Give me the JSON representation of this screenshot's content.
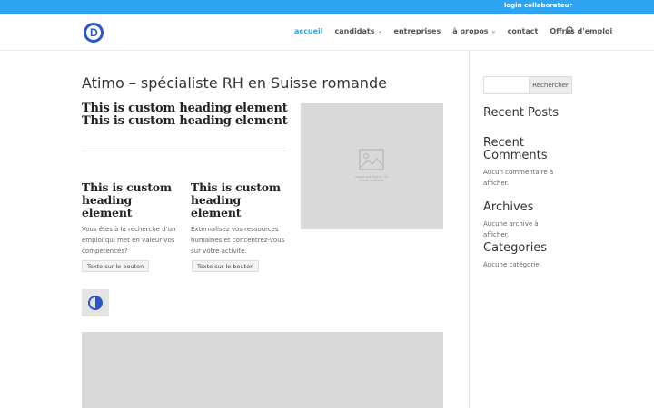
{
  "topbar": {
    "link_label": "login collaborateur"
  },
  "header": {
    "logo_letter": "D",
    "nav": [
      {
        "label": "accueil",
        "active": true,
        "has_dropdown": false
      },
      {
        "label": "candidats",
        "active": false,
        "has_dropdown": true
      },
      {
        "label": "entreprises",
        "active": false,
        "has_dropdown": false
      },
      {
        "label": "à propos",
        "active": false,
        "has_dropdown": true
      },
      {
        "label": "contact",
        "active": false,
        "has_dropdown": false
      },
      {
        "label": "Offres d'emploi",
        "active": false,
        "has_dropdown": false
      }
    ],
    "dropdown_icon": "chevron-down-icon",
    "search_icon": "search-icon"
  },
  "main": {
    "title": "Atimo – spécialiste RH en Suisse romande",
    "top_heading": [
      "This is custom heading element",
      "This is custom heading element"
    ],
    "columns": [
      {
        "heading": "This is custom heading element",
        "text": "Vous êtes à la recherche d'un emploi qui met en valeur vos compétences?",
        "button": "Texte sur le bouton"
      },
      {
        "heading": "This is custom heading element",
        "text": "Externalisez vos ressources humaines et concentrez-vous sur votre activité.",
        "button": "Texte sur le bouton"
      }
    ],
    "image_caption": "image not found / no image available",
    "toggle_icon": "contrast-icon"
  },
  "sidebar": {
    "search_placeholder": "",
    "search_button": "Rechercher",
    "recent_posts_title": "Recent Posts",
    "recent_comments_title": "Recent Comments",
    "recent_comments_text": "Aucun commentaire à afficher.",
    "archives_title": "Archives",
    "archives_text": "Aucune archive à afficher.",
    "categories_title": "Categories",
    "categories_text": "Aucune catégorie"
  },
  "colors": {
    "accent": "#2ea3f2",
    "logo": "#2b56c6",
    "placeholder": "#d9d9d9"
  }
}
